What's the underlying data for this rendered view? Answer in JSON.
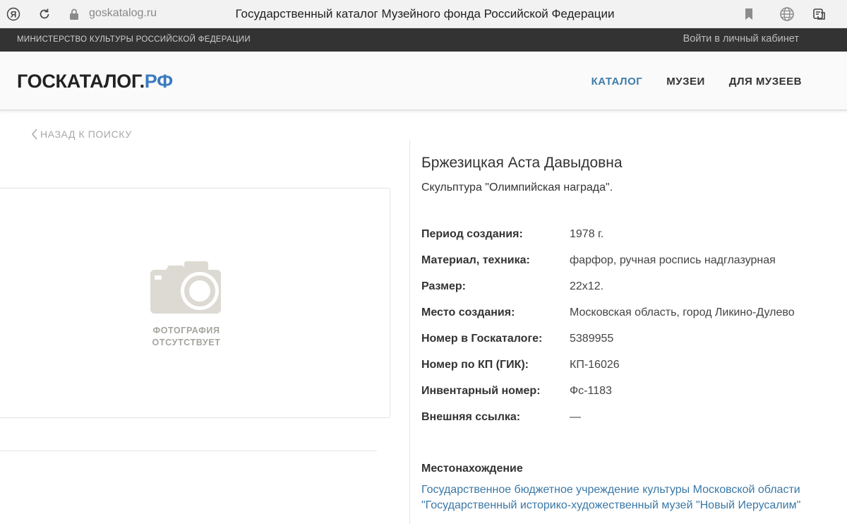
{
  "browser": {
    "url": "goskatalog.ru",
    "tab_title": "Государственный каталог Музейного фонда Российской Федерации"
  },
  "topbar": {
    "ministry": "МИНИСТЕРСТВО КУЛЬТУРЫ РОССИЙСКОЙ ФЕДЕРАЦИИ",
    "login": "Войти в личный кабинет"
  },
  "header": {
    "logo_main": "ГОСКАТАЛОГ.",
    "logo_accent": "РФ",
    "nav": [
      {
        "label": "КАТАЛОГ",
        "active": true
      },
      {
        "label": "МУЗЕИ",
        "active": false
      },
      {
        "label": "ДЛЯ МУЗЕЕВ",
        "active": false
      }
    ]
  },
  "back_link": "НАЗАД К ПОИСКУ",
  "photo": {
    "placeholder_line1": "ФОТОГРАФИЯ",
    "placeholder_line2": "ОТСУТСТВУЕТ"
  },
  "object": {
    "author": "Бржезицкая Аста Давыдовна",
    "title": "Скульптура \"Олимпийская награда\".",
    "attributes": [
      {
        "label": "Период создания:",
        "value": "1978 г."
      },
      {
        "label": "Материал, техника:",
        "value": "фарфор, ручная роспись надглазурная"
      },
      {
        "label": "Размер:",
        "value": "22x12."
      },
      {
        "label": "Место создания:",
        "value": "Московская область, город Ликино-Дулево"
      },
      {
        "label": "Номер в Госкаталоге:",
        "value": "5389955"
      },
      {
        "label": "Номер по КП (ГИК):",
        "value": "КП-16026"
      },
      {
        "label": "Инвентарный номер:",
        "value": "Фс-1183"
      },
      {
        "label": "Внешняя ссылка:",
        "value": "—"
      }
    ],
    "location_heading": "Местонахождение",
    "location_line1": "Государственное бюджетное учреждение культуры Московской области",
    "location_line2": "\"Государственный историко-художественный музей \"Новый Иерусалим\""
  },
  "colors": {
    "accent": "#3b7bbf",
    "nav_active": "#3f7ca8",
    "link": "#3a78a6",
    "topstrip": "#333333"
  },
  "icons": [
    "yandex-icon",
    "reload-icon",
    "lock-icon",
    "bookmark-icon",
    "globe-icon",
    "extension-icon",
    "chevron-left-icon",
    "camera-icon"
  ]
}
